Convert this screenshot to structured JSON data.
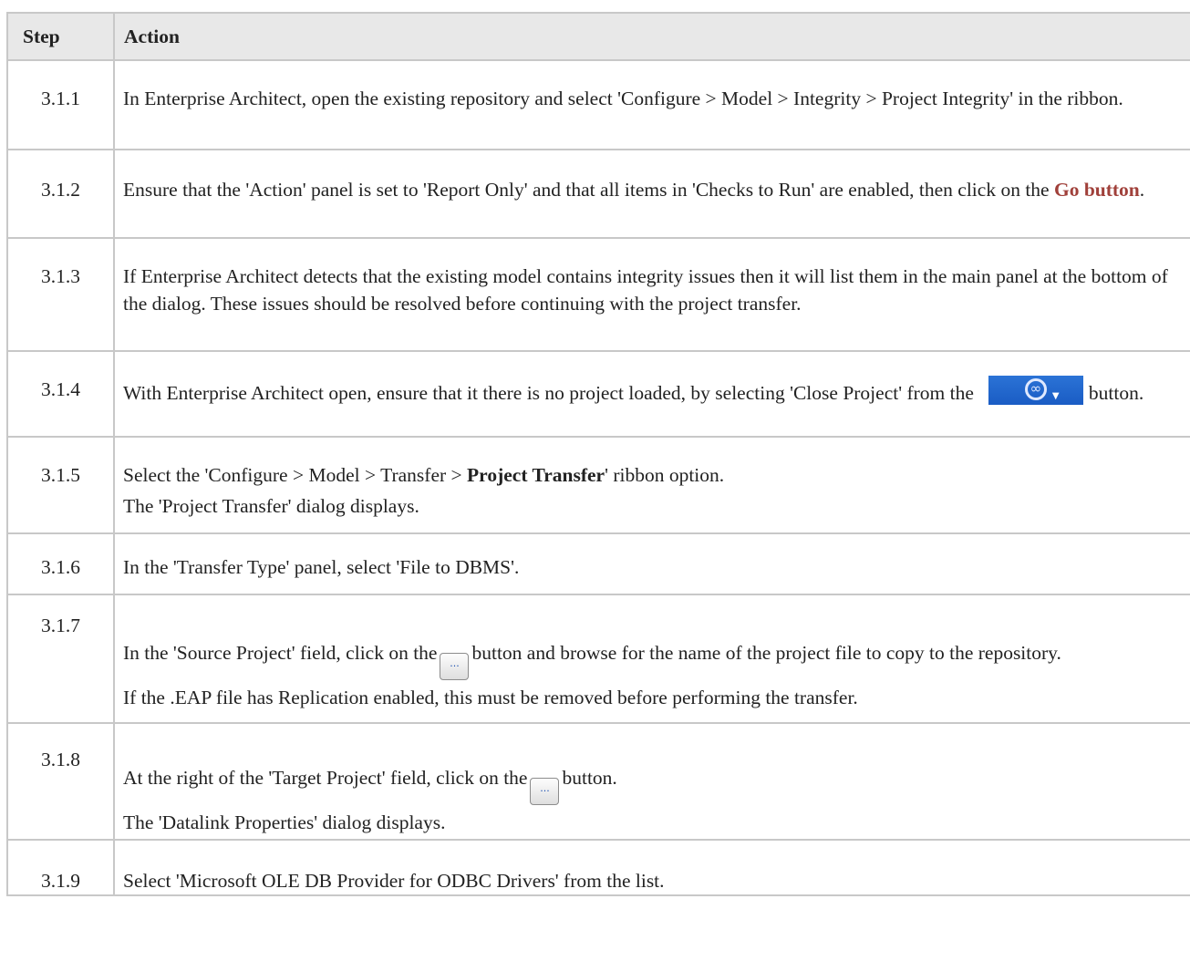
{
  "table": {
    "header": {
      "step": "Step",
      "action": "Action"
    },
    "rows": [
      {
        "step": "3.1.1",
        "text": "In Enterprise Architect, open the existing repository and select 'Configure > Model > Integrity > Project Integrity' in the ribbon."
      },
      {
        "step": "3.1.2",
        "text_before": "Ensure that the 'Action' panel is set to 'Report Only' and that all items in 'Checks to Run' are enabled, then click on the ",
        "link": "Go button",
        "text_after": "."
      },
      {
        "step": "3.1.3",
        "text": "If Enterprise Architect detects that the existing model contains integrity issues then it will list them in the main panel at the bottom of the dialog. These issues should be resolved before continuing with the project transfer."
      },
      {
        "step": "3.1.4",
        "text_before": "With Enterprise Architect open, ensure that it there is no project loaded, by selecting 'Close Project' from the",
        "icon": "ea-main-menu-icon",
        "text_after": "button."
      },
      {
        "step": "3.1.5",
        "text_before": "Select the 'Configure > Model > Transfer > ",
        "bold": "Project Transfer",
        "text_after": "' ribbon option.",
        "note": "The 'Project Transfer' dialog displays."
      },
      {
        "step": "3.1.6",
        "text": "In the 'Transfer Type' panel, select 'File to DBMS'."
      },
      {
        "step": "3.1.7",
        "text_before": "In the 'Source Project' field, click on the",
        "button_icon": "ellipsis-icon",
        "button_glyph": "...",
        "text_after": "button and browse for the name of the project file to copy to the repository.",
        "note": "If the .EAP file has Replication enabled, this must be removed before performing the transfer."
      },
      {
        "step": "3.1.8",
        "text_before": "At the right of the 'Target Project' field, click on the",
        "button_icon": "ellipsis-icon",
        "button_glyph": "...",
        "text_after": "button.",
        "note": "The 'Datalink Properties' dialog displays."
      },
      {
        "step": "3.1.9",
        "text": "Select 'Microsoft OLE DB Provider for ODBC Drivers' from the list."
      }
    ]
  },
  "colors": {
    "header_bg": "#e8e8e8",
    "border": "#c8c8c8",
    "link": "#a0403a",
    "ea_button": "#1f66cc"
  }
}
